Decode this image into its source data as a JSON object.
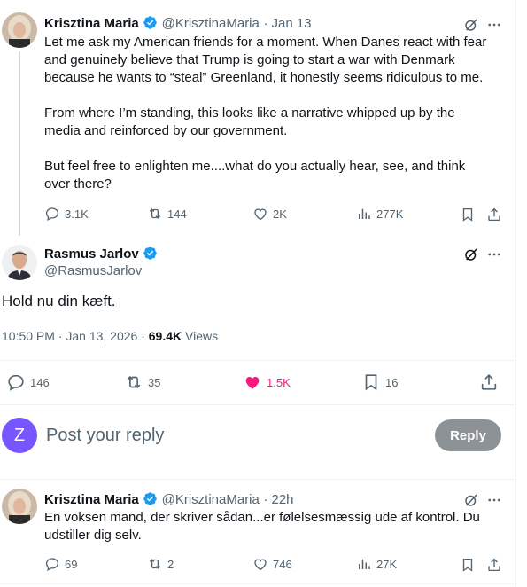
{
  "tweet1": {
    "name": "Krisztina Maria",
    "handle": "@KrisztinaMaria",
    "time": "· Jan 13",
    "text_lines": [
      "Let me ask my American friends for a moment. When Danes react with fear",
      "and genuinely believe that Trump is going to start a war with Denmark",
      "because he wants to “steal” Greenland, it honestly seems ridiculous to me.",
      "",
      "From where I’m standing, this looks like a narrative whipped up by the",
      "media and reinforced by our government.",
      "",
      "But feel free to enlighten me....what do you actually hear, see, and think",
      "over there?"
    ],
    "replies": "3.1K",
    "reposts": "144",
    "likes": "2K",
    "views": "277K"
  },
  "main": {
    "name": "Rasmus Jarlov",
    "handle": "@RasmusJarlov",
    "text": "Hold nu din kæft.",
    "timestamp": "10:50 PM · Jan 13, 2026 · ",
    "views_count": "69.4K",
    "views_label": " Views",
    "replies": "146",
    "reposts": "35",
    "likes": "1.5K",
    "bookmarks": "16"
  },
  "compose": {
    "avatar_letter": "Z",
    "placeholder": "Post your reply",
    "button": "Reply"
  },
  "tweet2": {
    "name": "Krisztina Maria",
    "handle": "@KrisztinaMaria",
    "time": "· 22h",
    "text_lines": [
      "En voksen mand, der skriver sådan...er følelsesmæssig ude af kontrol. Du",
      "udstiller dig selv."
    ],
    "replies": "69",
    "reposts": "2",
    "likes": "746",
    "views": "27K"
  },
  "colors": {
    "verified": "#1d9bf0",
    "like_active": "#f91880",
    "compose_avatar": "#7856ff",
    "muted": "#536471"
  }
}
